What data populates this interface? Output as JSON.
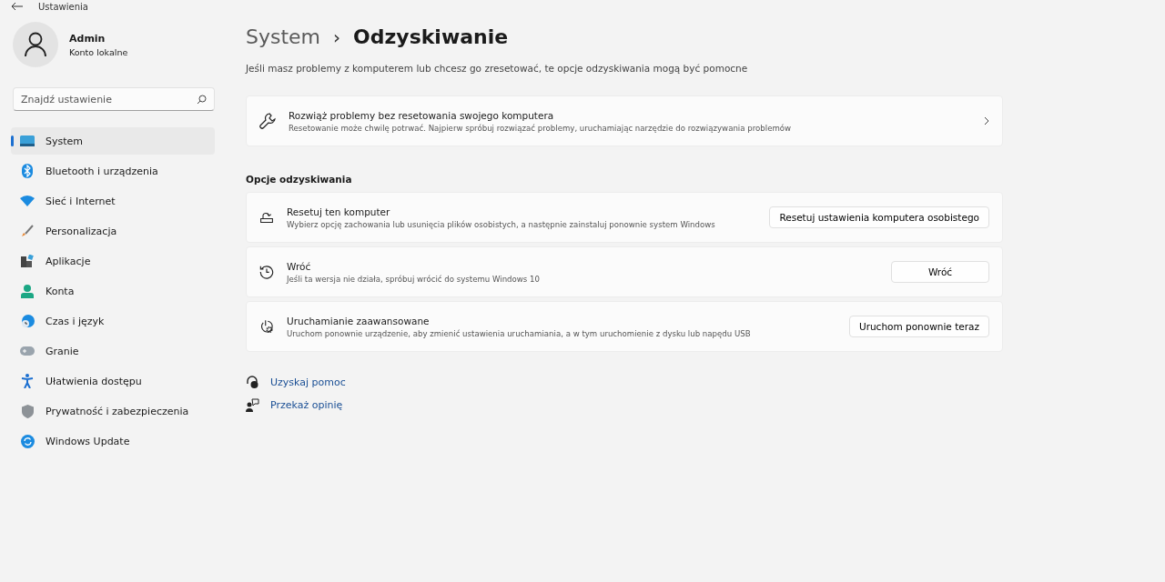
{
  "window": {
    "title": "Ustawienia"
  },
  "account": {
    "name": "Admin",
    "type": "Konto lokalne"
  },
  "search": {
    "placeholder": "Znajdź ustawienie"
  },
  "sidebar": {
    "items": [
      {
        "label": "System",
        "selected": true
      },
      {
        "label": "Bluetooth i urządzenia",
        "selected": false
      },
      {
        "label": "Sieć i Internet",
        "selected": false
      },
      {
        "label": "Personalizacja",
        "selected": false
      },
      {
        "label": "Aplikacje",
        "selected": false
      },
      {
        "label": "Konta",
        "selected": false
      },
      {
        "label": "Czas i język",
        "selected": false
      },
      {
        "label": "Granie",
        "selected": false
      },
      {
        "label": "Ułatwienia dostępu",
        "selected": false
      },
      {
        "label": "Prywatność i zabezpieczenia",
        "selected": false
      },
      {
        "label": "Windows Update",
        "selected": false
      }
    ]
  },
  "breadcrumb": {
    "parent": "System",
    "separator": "›",
    "current": "Odzyskiwanie"
  },
  "intro": "Jeśli masz problemy z komputerem lub chcesz go zresetować, te opcje odzyskiwania mogą być pomocne",
  "troubleshoot": {
    "title": "Rozwiąż problemy bez resetowania swojego komputera",
    "description": "Resetowanie może chwilę potrwać. Najpierw spróbuj rozwiązać problemy, uruchamiając narzędzie do rozwiązywania problemów"
  },
  "section_title": "Opcje odzyskiwania",
  "options": [
    {
      "title": "Resetuj ten komputer",
      "description": "Wybierz opcję zachowania lub usunięcia plików osobistych, a następnie zainstaluj ponownie system Windows",
      "button": "Resetuj ustawienia komputera osobistego"
    },
    {
      "title": "Wróć",
      "description": "Jeśli ta wersja nie działa, spróbuj wrócić do systemu Windows 10",
      "button": "Wróć"
    },
    {
      "title": "Uruchamianie zaawansowane",
      "description": "Uruchom ponownie urządzenie, aby zmienić ustawienia uruchamiania, a w tym uruchomienie z dysku lub napędu USB",
      "button": "Uruchom ponownie teraz"
    }
  ],
  "links": [
    "Uzyskaj pomoc",
    "Przekaż opinię"
  ]
}
